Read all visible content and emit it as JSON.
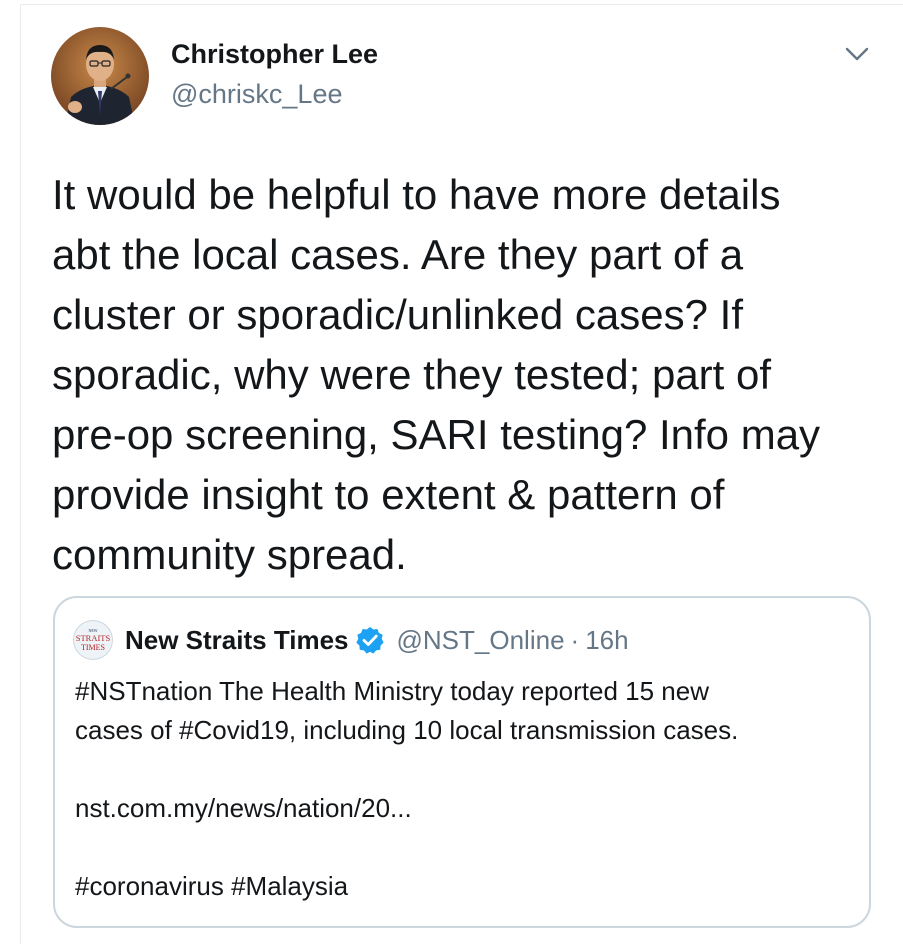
{
  "tweet": {
    "author": {
      "name": "Christopher Lee",
      "handle": "@chriskc_Lee",
      "avatar_icon": "person-portrait-avatar"
    },
    "menu_icon": "chevron-down-icon",
    "text": "It would be helpful to have more details\nabt the local cases. Are they part of a\ncluster or sporadic/unlinked cases? If\nsporadic, why were they tested; part of\npre-op screening, SARI testing? Info may\nprovide insight to extent & pattern of\ncommunity spread."
  },
  "quoted_tweet": {
    "author": {
      "name": "New Straits Times",
      "handle": "@NST_Online",
      "logo_icon": "nst-logo-icon",
      "verified_icon": "verified-badge-icon",
      "logo_text": "NEW STRAITS TIMES"
    },
    "separator": "·",
    "time": "16h",
    "lines": [
      "#NSTnation The Health Ministry today reported 15 new",
      "cases of #Covid19, including 10 local transmission cases."
    ],
    "link": "nst.com.my/news/nation/20...",
    "hashtags": "#coronavirus #Malaysia"
  },
  "colors": {
    "text_primary": "#14171a",
    "text_secondary": "#657786",
    "border": "#ccd6dd",
    "verified_blue": "#1da1f2"
  }
}
